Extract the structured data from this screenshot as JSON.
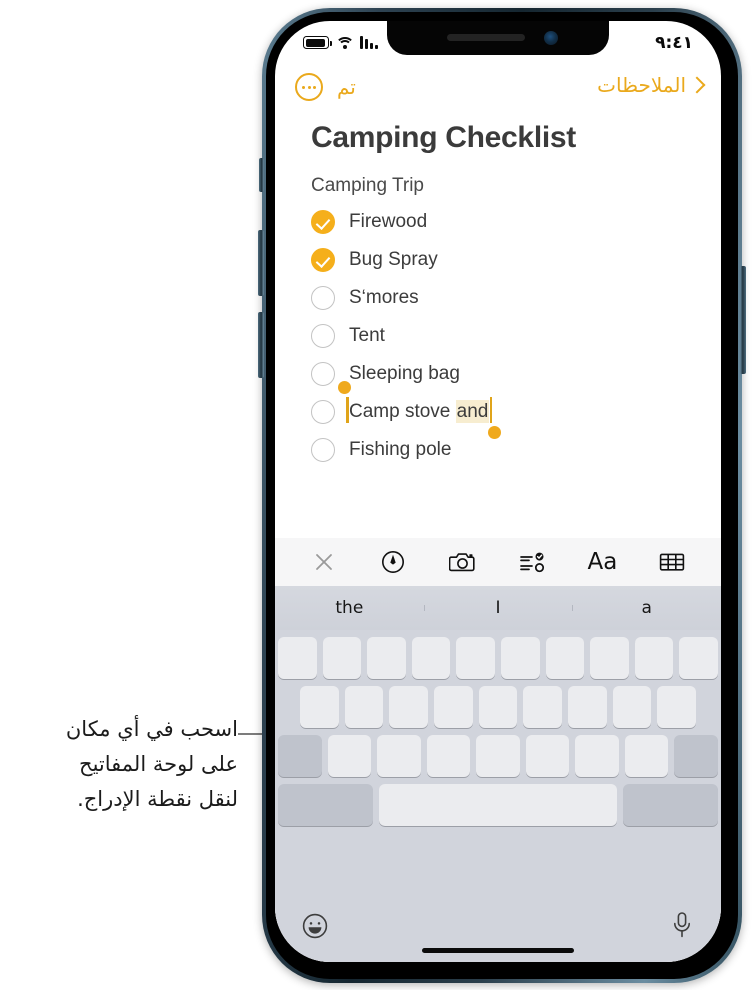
{
  "callout": {
    "text": "اسحب في أي مكان\nعلى لوحة المفاتيح\nلنقل نقطة الإدراج."
  },
  "status_bar": {
    "battery_icon": "battery-full-icon",
    "wifi_icon": "wifi-icon",
    "cellular_icon": "cellular-signal-icon",
    "time": "٩:٤١"
  },
  "nav_bar": {
    "back_label": "الملاحظات",
    "back_chevron_icon": "chevron-right-icon",
    "more_icon": "ellipsis-circle-icon",
    "done_label": "تم"
  },
  "note": {
    "title": "Camping Checklist",
    "subtitle": "Camping Trip",
    "items": [
      {
        "label": "Firewood",
        "checked": true
      },
      {
        "label": "Bug Spray",
        "checked": true
      },
      {
        "label": "S‘mores",
        "checked": false
      },
      {
        "label": "Tent",
        "checked": false
      },
      {
        "label": "Sleeping bag",
        "checked": false
      },
      {
        "label": "Camp stove ",
        "checked": false,
        "selected_text": "and"
      },
      {
        "label": "Fishing pole",
        "checked": false
      }
    ],
    "selection_color": "#f7edd0",
    "selection_handle_color": "#efa91d"
  },
  "note_toolbar": {
    "items": [
      {
        "icon": "close-x-icon",
        "name": "close-toolbar-button"
      },
      {
        "icon": "markup-pen-icon",
        "name": "markup-button"
      },
      {
        "icon": "camera-icon",
        "name": "camera-button"
      },
      {
        "icon": "checklist-icon",
        "name": "checklist-button"
      },
      {
        "icon": "text-format-aa-icon",
        "name": "format-button",
        "label": "Aa"
      },
      {
        "icon": "table-icon",
        "name": "table-button"
      }
    ]
  },
  "keyboard": {
    "predictions": [
      "the",
      "I",
      "a"
    ],
    "rows": [
      {
        "keys": 10,
        "leading_dark": false,
        "trailing_dark": false
      },
      {
        "keys": 9,
        "leading_dark": false,
        "trailing_dark": false
      },
      {
        "keys": 7,
        "leading_dark": true,
        "trailing_dark": true
      },
      {
        "keys": 1,
        "leading_dark": true,
        "trailing_dark": true
      }
    ],
    "emoji_icon": "emoji-smiley-icon",
    "mic_icon": "microphone-icon",
    "home_indicator": "home-indicator"
  },
  "colors": {
    "accent": "#eaa91c",
    "checkbox_checked": "#f5af1b",
    "keyboard_bg": "#d1d4dc",
    "key_bg": "#ebecef",
    "key_dark_bg": "#bfc3cc",
    "toolbar_bg": "#f6f6f7"
  }
}
